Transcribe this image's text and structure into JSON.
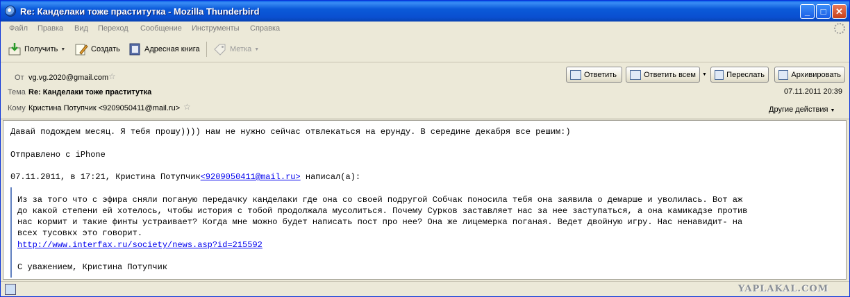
{
  "window": {
    "title": "Re: Канделаки тоже праститутка - Mozilla Thunderbird",
    "min": "_",
    "max": "□",
    "close": "✕"
  },
  "menu": [
    "Файл",
    "Правка",
    "Вид",
    "Переход",
    "Сообщение",
    "Инструменты",
    "Справка"
  ],
  "toolbar": {
    "get": "Получить",
    "write": "Создать",
    "addressbook": "Адресная книга",
    "tag": "Метка"
  },
  "header": {
    "from_label": "От",
    "from_value": "vg.vg.2020@gmail.com",
    "subject_label": "Тема",
    "subject_value": "Re: Канделаки тоже праститутка",
    "to_label": "Кому",
    "to_value": "Кристина Потупчик <9209050411@mail.ru>",
    "date": "07.11.2011 20:39",
    "other_actions": "Другие действия",
    "buttons": {
      "reply": "Ответить",
      "reply_all": "Ответить всем",
      "forward": "Переслать",
      "archive": "Архивировать"
    }
  },
  "body": {
    "line1": "Давай подождем месяц. Я тебя прошу)))) нам не нужно сейчас отвлекаться на ерунду. В середине декабря все решим:)",
    "line2": "Отправлено с iPhone",
    "attribution_prefix": "07.11.2011, в 17:21, Кристина Потупчик",
    "attribution_email": "<9209050411@mail.ru>",
    "attribution_suffix": " написал(а):",
    "quote": [
      "Из за того что с эфира сняли поганую передачку канделаки где она со своей подругой Собчак поносила тебя она заявила о демарше и уволилась. Вот аж",
      "до какой степени ей хотелось, чтобы история с тобой продолжала мусолиться. Почему Сурков заставляет нас за нее заступаться, а она камикадзе против",
      "нас кормит и такие финты устраивает? Когда мне можно будет написать пост про нее? Она же лицемерка поганая. Ведет двойную игру. Нас ненавидит- на",
      "всех тусовкх это говорит."
    ],
    "quote_link": "http://www.interfax.ru/society/news.asp?id=215592",
    "signature": "С уважением, Кристина Потупчик"
  },
  "status": {
    "watermark": "YAPLAKAL.COM"
  }
}
